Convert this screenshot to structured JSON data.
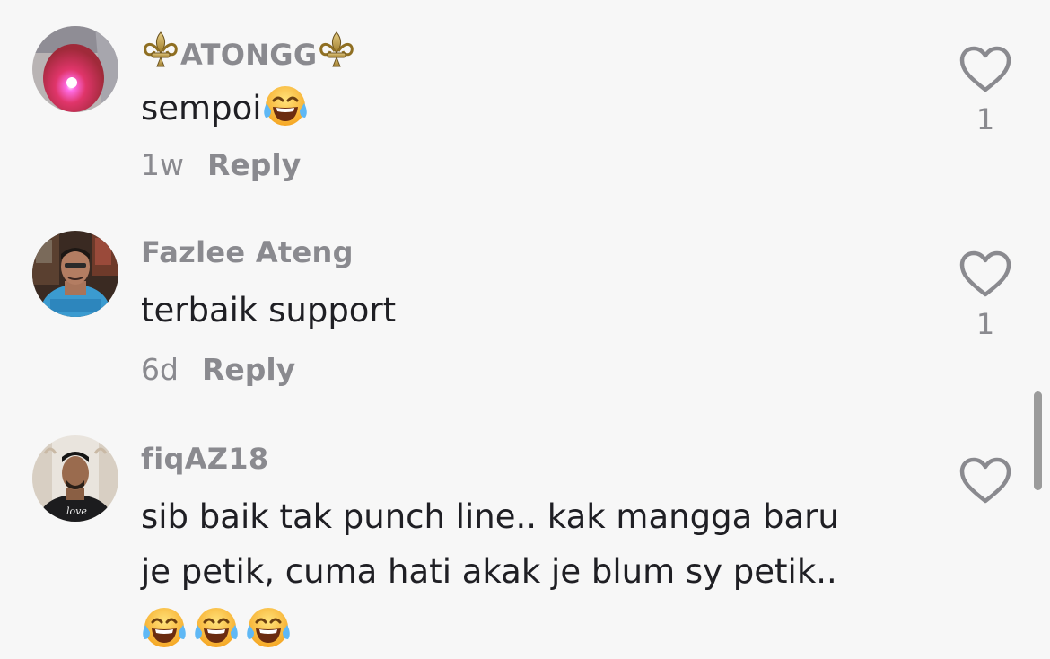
{
  "comments": [
    {
      "username": "ATONGG",
      "text": "sempoi",
      "time": "1w",
      "reply_label": "Reply",
      "likes": "1",
      "avatar_icon": "avatar-pink-glow"
    },
    {
      "username": "Fazlee Ateng",
      "text": "terbaik support",
      "time": "6d",
      "reply_label": "Reply",
      "likes": "1",
      "avatar_icon": "avatar-man-blue-shirt"
    },
    {
      "username": "fiqAZ18",
      "text_line1": "sib baik tak punch line.. kak mangga baru",
      "text_line2": "je petik, cuma hati akak je blum sy petik..",
      "avatar_icon": "avatar-man-black-shirt"
    }
  ],
  "colors": {
    "background": "#f7f7f7",
    "username": "#8a8a8f",
    "text": "#1f1f24",
    "meta": "#8a8a8f",
    "heart_outline": "#8a8a8f",
    "scrollbar": "#9b9b9b"
  },
  "icons": {
    "username_decoration": "fleur-de-lis-icon",
    "emoji": "face-with-tears-of-joy-icon",
    "like": "heart-outline-icon"
  }
}
